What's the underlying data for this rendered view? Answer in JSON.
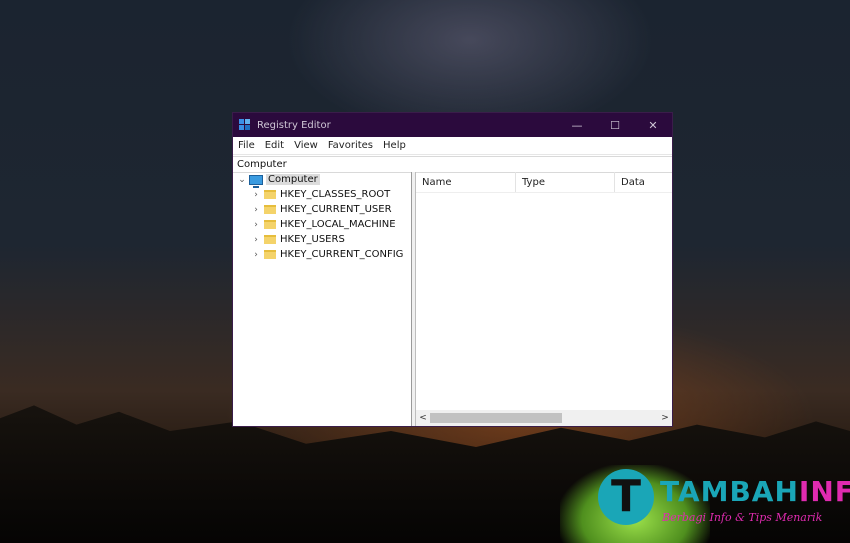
{
  "window": {
    "title": "Registry Editor",
    "controls": {
      "minimize": "—",
      "maximize": "☐",
      "close": "✕"
    }
  },
  "menu": [
    "File",
    "Edit",
    "View",
    "Favorites",
    "Help"
  ],
  "address": "Computer",
  "tree": {
    "root": "Computer",
    "items": [
      "HKEY_CLASSES_ROOT",
      "HKEY_CURRENT_USER",
      "HKEY_LOCAL_MACHINE",
      "HKEY_USERS",
      "HKEY_CURRENT_CONFIG"
    ]
  },
  "list": {
    "columns": [
      "Name",
      "Type",
      "Data"
    ]
  },
  "scrollbar": {
    "left": "<",
    "right": ">",
    "thumb_fraction": 0.58
  },
  "watermark": {
    "logo_letter": "T",
    "brand_part1": "TAMBAH",
    "brand_part2": "INFO",
    "tagline": "Berbagi Info & Tips Menarik"
  },
  "colors": {
    "titlebar": "#2b0a3d",
    "accent_icon": "#3a8ee6",
    "folder": "#f4d36a",
    "watermark_teal": "#1aa6b7",
    "watermark_pink": "#e02bb0"
  },
  "icons": {
    "app": "registry-icon",
    "computer": "computer-icon",
    "folder": "folder-icon",
    "expand": "chevron-right-icon",
    "collapse": "chevron-down-icon"
  }
}
